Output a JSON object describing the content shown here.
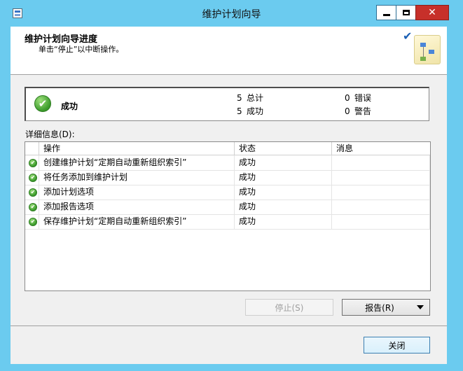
{
  "window": {
    "title": "维护计划向导",
    "close_glyph": "✕"
  },
  "header": {
    "title": "维护计划向导进度",
    "subtitle": "单击“停止”以中断操作。",
    "check_glyph": "✔"
  },
  "summary": {
    "status": "成功",
    "check_glyph": "✔",
    "stats": [
      {
        "num": "5",
        "label": "总计"
      },
      {
        "num": "0",
        "label": "错误"
      },
      {
        "num": "5",
        "label": "成功"
      },
      {
        "num": "0",
        "label": "警告"
      }
    ]
  },
  "details": {
    "label": "详细信息(D):",
    "columns": [
      "操作",
      "状态",
      "消息"
    ],
    "rows": [
      {
        "action": "创建维护计划“定期自动重新组织索引”",
        "status": "成功",
        "message": ""
      },
      {
        "action": "将任务添加到维护计划",
        "status": "成功",
        "message": ""
      },
      {
        "action": "添加计划选项",
        "status": "成功",
        "message": ""
      },
      {
        "action": "添加报告选项",
        "status": "成功",
        "message": ""
      },
      {
        "action": "保存维护计划“定期自动重新组织索引”",
        "status": "成功",
        "message": ""
      }
    ]
  },
  "buttons": {
    "stop": "停止(S)",
    "report": "报告(R)",
    "close": "关闭"
  },
  "colors": {
    "frame": "#6bcbef",
    "close_button": "#c7302a",
    "success": "#3a9a2a"
  }
}
